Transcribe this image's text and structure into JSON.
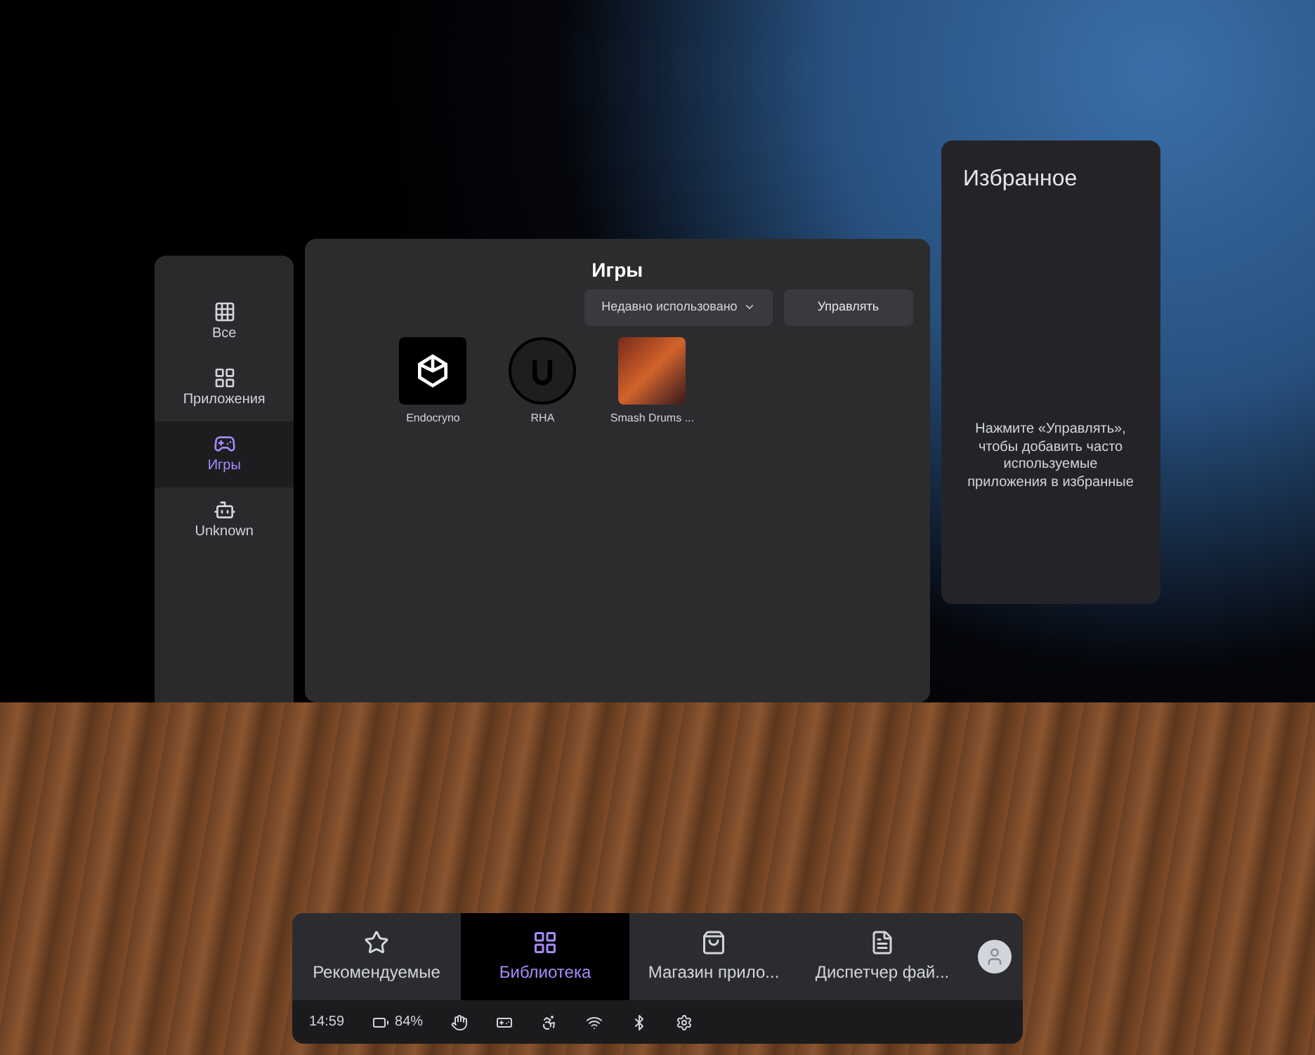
{
  "sidebar": {
    "items": [
      {
        "label": "Все",
        "selected": false
      },
      {
        "label": "Приложения",
        "selected": false
      },
      {
        "label": "Игры",
        "selected": true
      },
      {
        "label": "Unknown",
        "selected": false
      }
    ]
  },
  "library": {
    "title": "Игры",
    "sort_dropdown": "Недавно использовано",
    "manage_button": "Управлять",
    "apps": [
      {
        "name": "Endocryno"
      },
      {
        "name": "RHA"
      },
      {
        "name": "Smash Drums ..."
      }
    ]
  },
  "favorites": {
    "title": "Избранное",
    "message": "Нажмите «Управлять», чтобы добавить часто используемые приложения в избранные"
  },
  "dock": {
    "tabs": [
      {
        "label": "Рекомендуемые",
        "selected": false
      },
      {
        "label": "Библиотека",
        "selected": true
      },
      {
        "label": "Магазин прило...",
        "selected": false
      },
      {
        "label": "Диспетчер фай...",
        "selected": false
      }
    ],
    "time": "14:59",
    "battery": "84%"
  }
}
